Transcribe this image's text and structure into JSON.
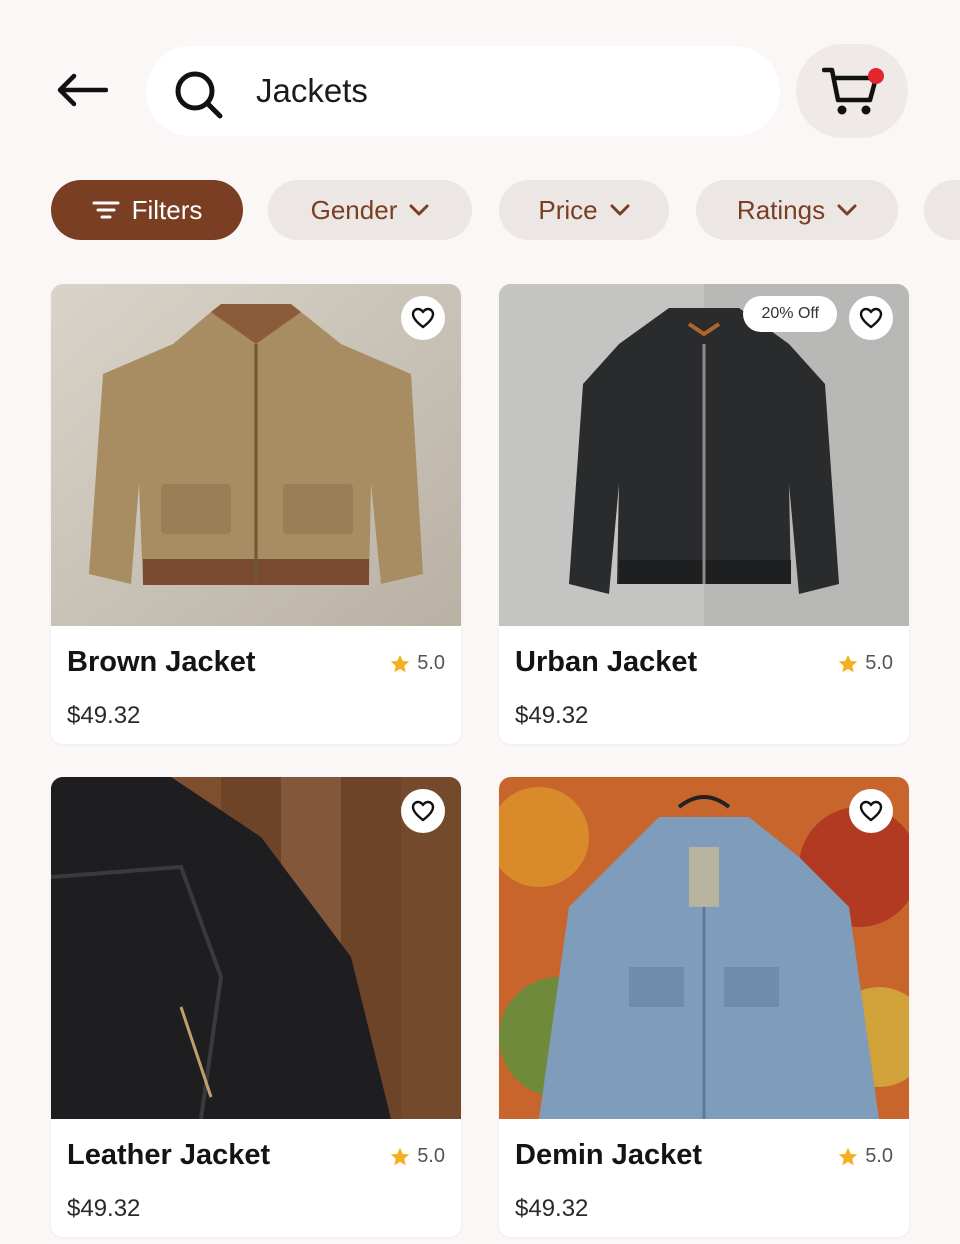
{
  "search": {
    "value": "Jackets",
    "placeholder": "Search"
  },
  "filters": {
    "filters_label": "Filters",
    "chips": [
      "Gender",
      "Price",
      "Ratings"
    ]
  },
  "colors": {
    "accent": "#7a3e22",
    "chip_text": "#7a3e22",
    "star": "#f2b01e",
    "cart_dot": "#e3262b"
  },
  "products": [
    {
      "name": "Brown Jacket",
      "rating": "5.0",
      "price": "$49.32",
      "badge": ""
    },
    {
      "name": "Urban Jacket",
      "rating": "5.0",
      "price": "$49.32",
      "badge": "20% Off"
    },
    {
      "name": "Leather Jacket",
      "rating": "5.0",
      "price": "$49.32",
      "badge": ""
    },
    {
      "name": "Demin Jacket",
      "rating": "5.0",
      "price": "$49.32",
      "badge": ""
    }
  ],
  "icons": {
    "back": "arrow-left-icon",
    "search": "search-icon",
    "cart": "cart-icon",
    "filter": "filter-lines-icon",
    "chevron": "chevron-down-icon",
    "favorite": "heart-outline-icon",
    "star": "star-icon"
  }
}
